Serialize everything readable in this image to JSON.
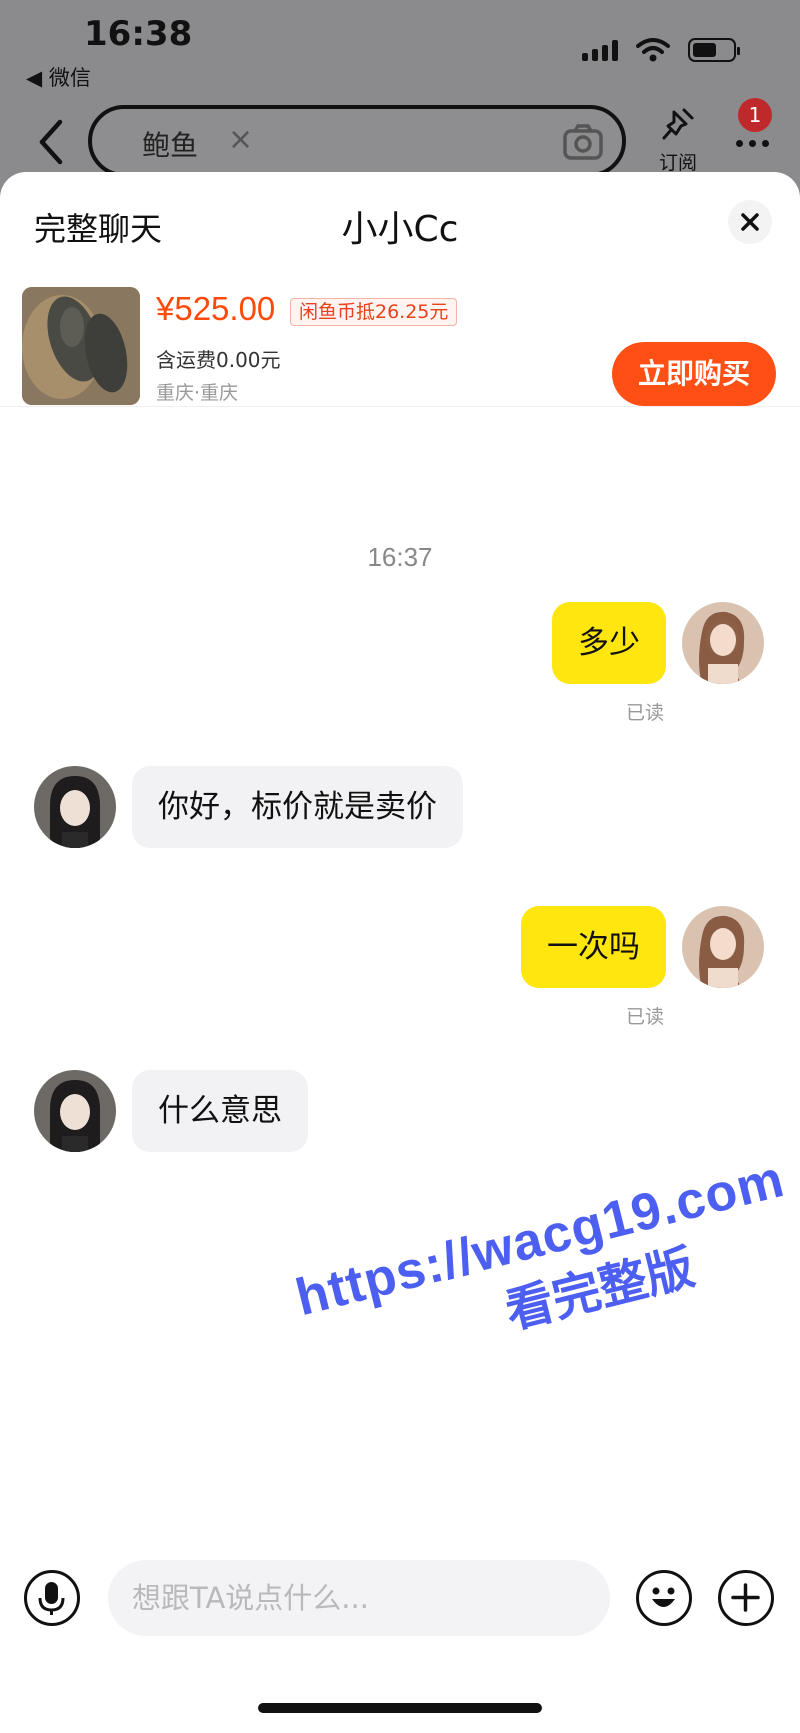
{
  "status_bar": {
    "time": "16:38",
    "back_app": "◀ 微信"
  },
  "search": {
    "query": "鲍鱼",
    "clear": "×"
  },
  "nav": {
    "subscribe_label": "订阅",
    "badge_count": "1"
  },
  "sheet": {
    "full_chat_label": "完整聊天",
    "title": "小小Cc"
  },
  "product": {
    "price": "¥525.00",
    "coin_discount": "闲鱼币抵26.25元",
    "shipping": "含运费0.00元",
    "location": "重庆·重庆",
    "buy_label": "立即购买"
  },
  "chat": {
    "timestamp": "16:37",
    "messages": [
      {
        "from": "me",
        "text": "多少",
        "status": "已读"
      },
      {
        "from": "them",
        "text": "你好，标价就是卖价"
      },
      {
        "from": "me",
        "text": "一次吗",
        "status": "已读"
      },
      {
        "from": "them",
        "text": "什么意思"
      }
    ]
  },
  "watermark": {
    "url": "https://wacg19.com",
    "subtitle": "看完整版"
  },
  "input": {
    "placeholder": "想跟TA说点什么..."
  },
  "colors": {
    "accent_yellow": "#ffe60f",
    "buy_orange": "#ff4f14",
    "price_red": "#ff4a0a"
  },
  "icons": [
    "back-chevron-icon",
    "camera-icon",
    "pin-icon",
    "more-icon",
    "close-icon",
    "mic-icon",
    "emoji-icon",
    "plus-icon"
  ]
}
